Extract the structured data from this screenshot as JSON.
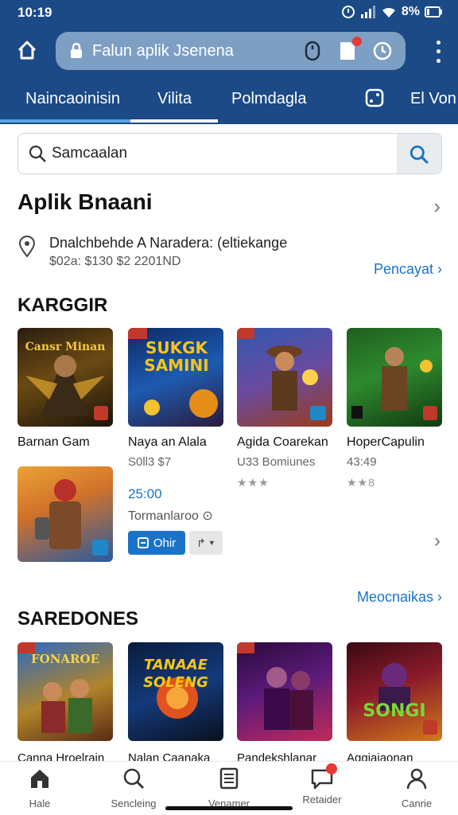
{
  "status_bar": {
    "time": "10:19",
    "battery": "8%"
  },
  "browser": {
    "url_text": "Falun aplik Jsenena"
  },
  "tabs": [
    {
      "label": "Naincaoinisin",
      "active": false
    },
    {
      "label": "Vilita",
      "active": true
    },
    {
      "label": "Polmdagla",
      "active": false
    },
    {
      "label": "",
      "active": false
    },
    {
      "label": "El Von",
      "active": false
    }
  ],
  "search": {
    "value": "Samcaalan"
  },
  "app_section": {
    "title": "Aplik Bnaani",
    "location_line1": "Dnalchbehde A Naradera: (eltiekange",
    "location_line2": "$02a: $130 $2 2201ND",
    "link": "Pencayat"
  },
  "karggir": {
    "heading": "KARGGIR",
    "items": [
      {
        "title": "Barnan Gam",
        "art_text": "Cansr Minan",
        "meta": "",
        "stars": ""
      },
      {
        "title": "Naya an Alala",
        "art_text": "SUKGK SAMINI",
        "meta": "S0ll3 $7",
        "stars": ""
      },
      {
        "title": "Agida Coarekan",
        "art_text": "",
        "meta": "U33 Bomiunes",
        "stars": "★★★"
      },
      {
        "title": "HoperCapulin",
        "art_text": "",
        "meta": "43:49",
        "stars": "★★8"
      }
    ],
    "featured": {
      "price": "25:00",
      "meta": "Tormanlaroo",
      "open_label": "Ohir"
    }
  },
  "saredones": {
    "heading": "SAREDONES",
    "more_link": "Meocnaikas",
    "items": [
      {
        "title": "Canna Hroelrain",
        "art_text": "FONAROE"
      },
      {
        "title": "Nalan Caanaka",
        "art_text": "TANAAE SOLENG"
      },
      {
        "title": "Pandekshlanar",
        "art_text": ""
      },
      {
        "title": "Aggiajaonan",
        "art_text": "SONGI"
      }
    ]
  },
  "bottom_nav": [
    {
      "label": "Hale",
      "icon": "home-icon"
    },
    {
      "label": "Sencleing",
      "icon": "search-icon"
    },
    {
      "label": "Venamer",
      "icon": "document-icon"
    },
    {
      "label": "Retaider",
      "icon": "message-icon"
    },
    {
      "label": "Canrie",
      "icon": "person-icon"
    }
  ],
  "colors": {
    "header": "#1b4a86",
    "accent": "#1a73c8",
    "badge": "#e53935"
  }
}
